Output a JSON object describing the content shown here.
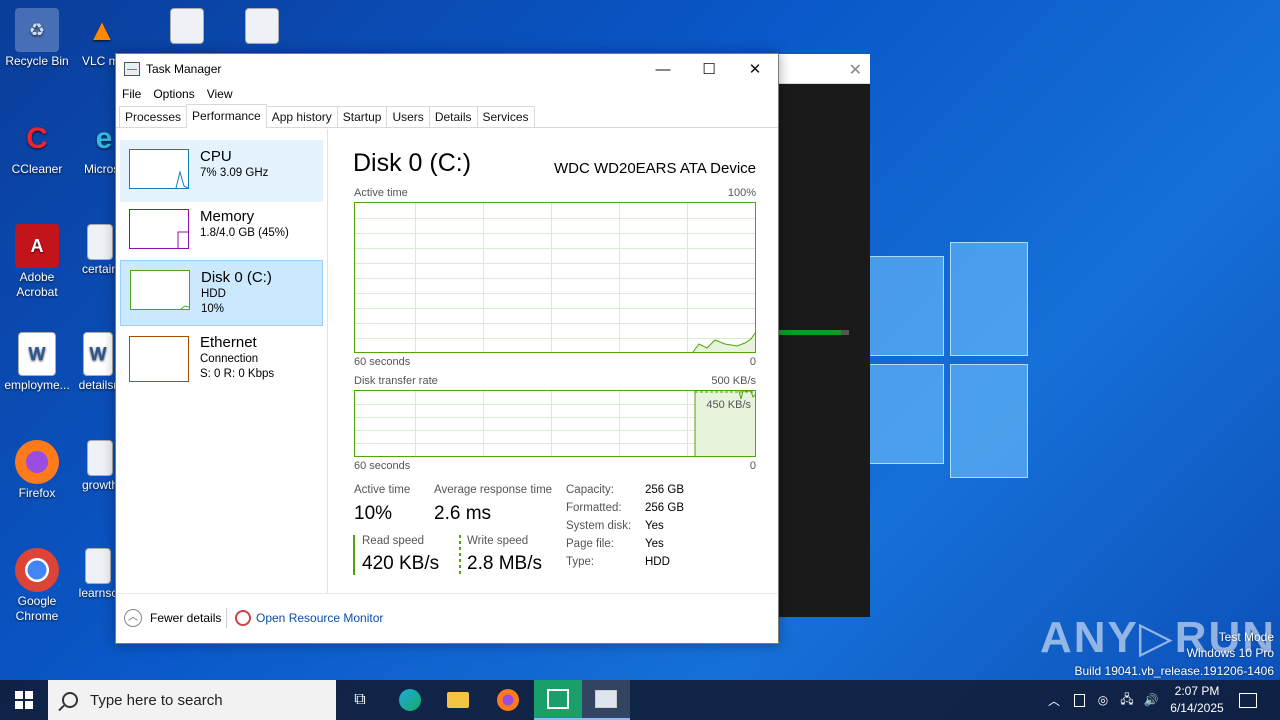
{
  "desktop": {
    "icons": [
      {
        "label": "Recycle Bin"
      },
      {
        "label": "VLC media player"
      },
      {
        "label": "CCleaner"
      },
      {
        "label": "Microsoft Edge"
      },
      {
        "label": "Adobe Acrobat"
      },
      {
        "label": "certain"
      },
      {
        "label": "employme..."
      },
      {
        "label": "detailsr"
      },
      {
        "label": "Firefox"
      },
      {
        "label": "growth"
      },
      {
        "label": "Google Chrome"
      },
      {
        "label": "learnsc"
      }
    ]
  },
  "task_manager": {
    "title": "Task Manager",
    "menu": [
      "File",
      "Options",
      "View"
    ],
    "tabs": [
      "Processes",
      "Performance",
      "App history",
      "Startup",
      "Users",
      "Details",
      "Services"
    ],
    "active_tab": "Performance",
    "sidebar": [
      {
        "name": "CPU",
        "sub1": "7%  3.09 GHz",
        "sub2": ""
      },
      {
        "name": "Memory",
        "sub1": "1.8/4.0 GB (45%)",
        "sub2": ""
      },
      {
        "name": "Disk 0 (C:)",
        "sub1": "HDD",
        "sub2": "10%"
      },
      {
        "name": "Ethernet",
        "sub1": "Connection",
        "sub2": "S: 0  R: 0 Kbps"
      }
    ],
    "disk": {
      "title": "Disk 0 (C:)",
      "model": "WDC WD20EARS ATA Device",
      "active_time_label": "Active time",
      "active_time_max": "100%",
      "seconds_label": "60 seconds",
      "zero": "0",
      "transfer_label": "Disk transfer rate",
      "transfer_max": "500 KB/s",
      "transfer_marker": "450 KB/s",
      "stats": {
        "active_time_label": "Active time",
        "active_time_value": "10%",
        "avg_response_label": "Average response time",
        "avg_response_value": "2.6 ms",
        "read_label": "Read speed",
        "read_value": "420 KB/s",
        "write_label": "Write speed",
        "write_value": "2.8 MB/s"
      },
      "info": [
        {
          "k": "Capacity:",
          "v": "256 GB"
        },
        {
          "k": "Formatted:",
          "v": "256 GB"
        },
        {
          "k": "System disk:",
          "v": "Yes"
        },
        {
          "k": "Page file:",
          "v": "Yes"
        },
        {
          "k": "Type:",
          "v": "HDD"
        }
      ]
    },
    "footer": {
      "fewer_details": "Fewer details",
      "open_resource_monitor": "Open Resource Monitor"
    }
  },
  "taskbar": {
    "search_placeholder": "Type here to search",
    "time": "2:07 PM",
    "date": "6/14/2025"
  },
  "watermark": {
    "line1": "Test Mode",
    "line2": "Windows 10 Pro",
    "line3": "Build 19041.vb_release.191206-1406",
    "brand": "ANY RUN"
  }
}
